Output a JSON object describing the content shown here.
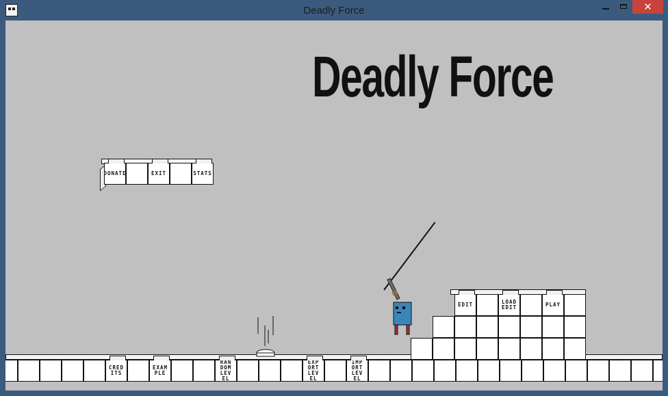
{
  "window": {
    "title": "Deadly Force",
    "app_icon": "panda-icon"
  },
  "game": {
    "title": "Deadly Force",
    "menu_float": {
      "donate": "DONATE",
      "exit": "EXIT",
      "stats": "STATS"
    },
    "menu_top": {
      "edit": "EDIT",
      "load_edit": "LOAD\nEDIT",
      "play": "PLAY"
    },
    "menu_ground": {
      "credits": "CRED\nITS",
      "example": "EXAM\nPLE",
      "random_level": "RAN\nDOM\nLEV\nEL",
      "export_level": "EXP\nORT\nLEV\nEL",
      "import_level": "IMP\nORT\nLEV\nEL"
    }
  }
}
